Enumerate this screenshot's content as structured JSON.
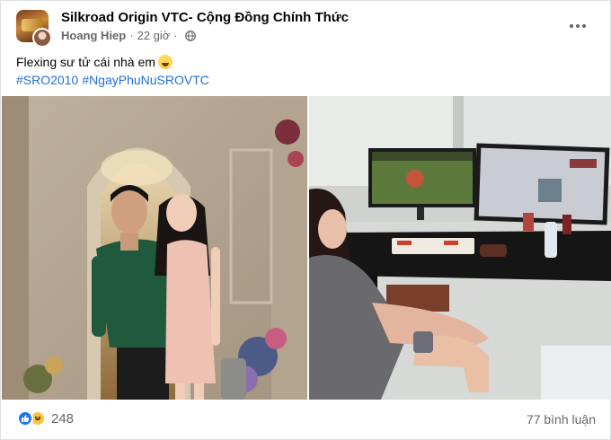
{
  "post": {
    "page_name": "Silkroad Origin VTC- Cộng Đồng Chính Thức",
    "author": "Hoang Hiep",
    "time": "22 giờ",
    "audience_icon": "globe-icon",
    "text": "Flexing sư tử cái nhà em",
    "hashtags": [
      "#SRO2010",
      "#NgayPhuNuSROVTC"
    ]
  },
  "photos": [
    {
      "name": "photo-couple"
    },
    {
      "name": "photo-gaming-setup"
    }
  ],
  "reactions": {
    "icons": [
      "like-icon",
      "haha-icon"
    ],
    "count": "248"
  },
  "comments": {
    "label": "77 bình luận"
  },
  "colors": {
    "link": "#216fdb",
    "like": "#1877f2",
    "secondary_text": "#65676b"
  }
}
